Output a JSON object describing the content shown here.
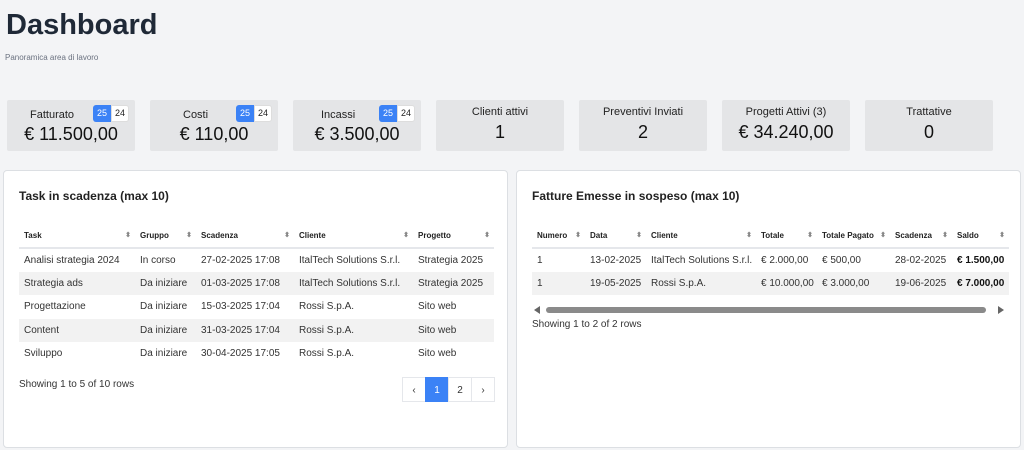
{
  "header": {
    "title": "Dashboard",
    "subtitle": "Panoramica area di lavoro"
  },
  "stats": [
    {
      "label": "Fatturato",
      "value": "€ 11.500,00",
      "year_active": "25",
      "year_other": "24"
    },
    {
      "label": "Costi",
      "value": "€ 110,00",
      "year_active": "25",
      "year_other": "24"
    },
    {
      "label": "Incassi",
      "value": "€ 3.500,00",
      "year_active": "25",
      "year_other": "24"
    },
    {
      "label": "Clienti attivi",
      "value": "1"
    },
    {
      "label": "Preventivi Inviati",
      "value": "2"
    },
    {
      "label": "Progetti Attivi (3)",
      "value": "€ 34.240,00"
    },
    {
      "label": "Trattative",
      "value": "0"
    }
  ],
  "tasks": {
    "title": "Task in scadenza (max 10)",
    "columns": [
      "Task",
      "Gruppo",
      "Scadenza",
      "Cliente",
      "Progetto"
    ],
    "rows": [
      [
        "Analisi strategia 2024",
        "In corso",
        "27-02-2025 17:08",
        "ItalTech Solutions S.r.l.",
        "Strategia 2025"
      ],
      [
        "Strategia ads",
        "Da iniziare",
        "01-03-2025 17:08",
        "ItalTech Solutions S.r.l.",
        "Strategia 2025"
      ],
      [
        "Progettazione",
        "Da iniziare",
        "15-03-2025 17:04",
        "Rossi S.p.A.",
        "Sito web"
      ],
      [
        "Content",
        "Da iniziare",
        "31-03-2025 17:04",
        "Rossi S.p.A.",
        "Sito web"
      ],
      [
        "Sviluppo",
        "Da iniziare",
        "30-04-2025 17:05",
        "Rossi S.p.A.",
        "Sito web"
      ]
    ],
    "footer": "Showing 1 to 5 of 10 rows",
    "pagination": {
      "prev": "‹",
      "pages": [
        "1",
        "2"
      ],
      "next": "›",
      "active": "1"
    }
  },
  "invoices": {
    "title": "Fatture Emesse in sospeso (max 10)",
    "columns": [
      "Numero",
      "Data",
      "Cliente",
      "Totale",
      "Totale Pagato",
      "Scadenza",
      "Saldo"
    ],
    "rows": [
      [
        "1",
        "13-02-2025",
        "ItalTech Solutions S.r.l.",
        "€ 2.000,00",
        "€ 500,00",
        "28-02-2025",
        "€ 1.500,00"
      ],
      [
        "1",
        "19-05-2025",
        "Rossi S.p.A.",
        "€ 10.000,00",
        "€ 3.000,00",
        "19-06-2025",
        "€ 7.000,00"
      ]
    ],
    "footer": "Showing 1 to 2 of 2 rows"
  },
  "colors": {
    "accent": "#3b82f6",
    "stat_bg": "#e4e5e7",
    "page_bg": "#f3f4f6"
  }
}
